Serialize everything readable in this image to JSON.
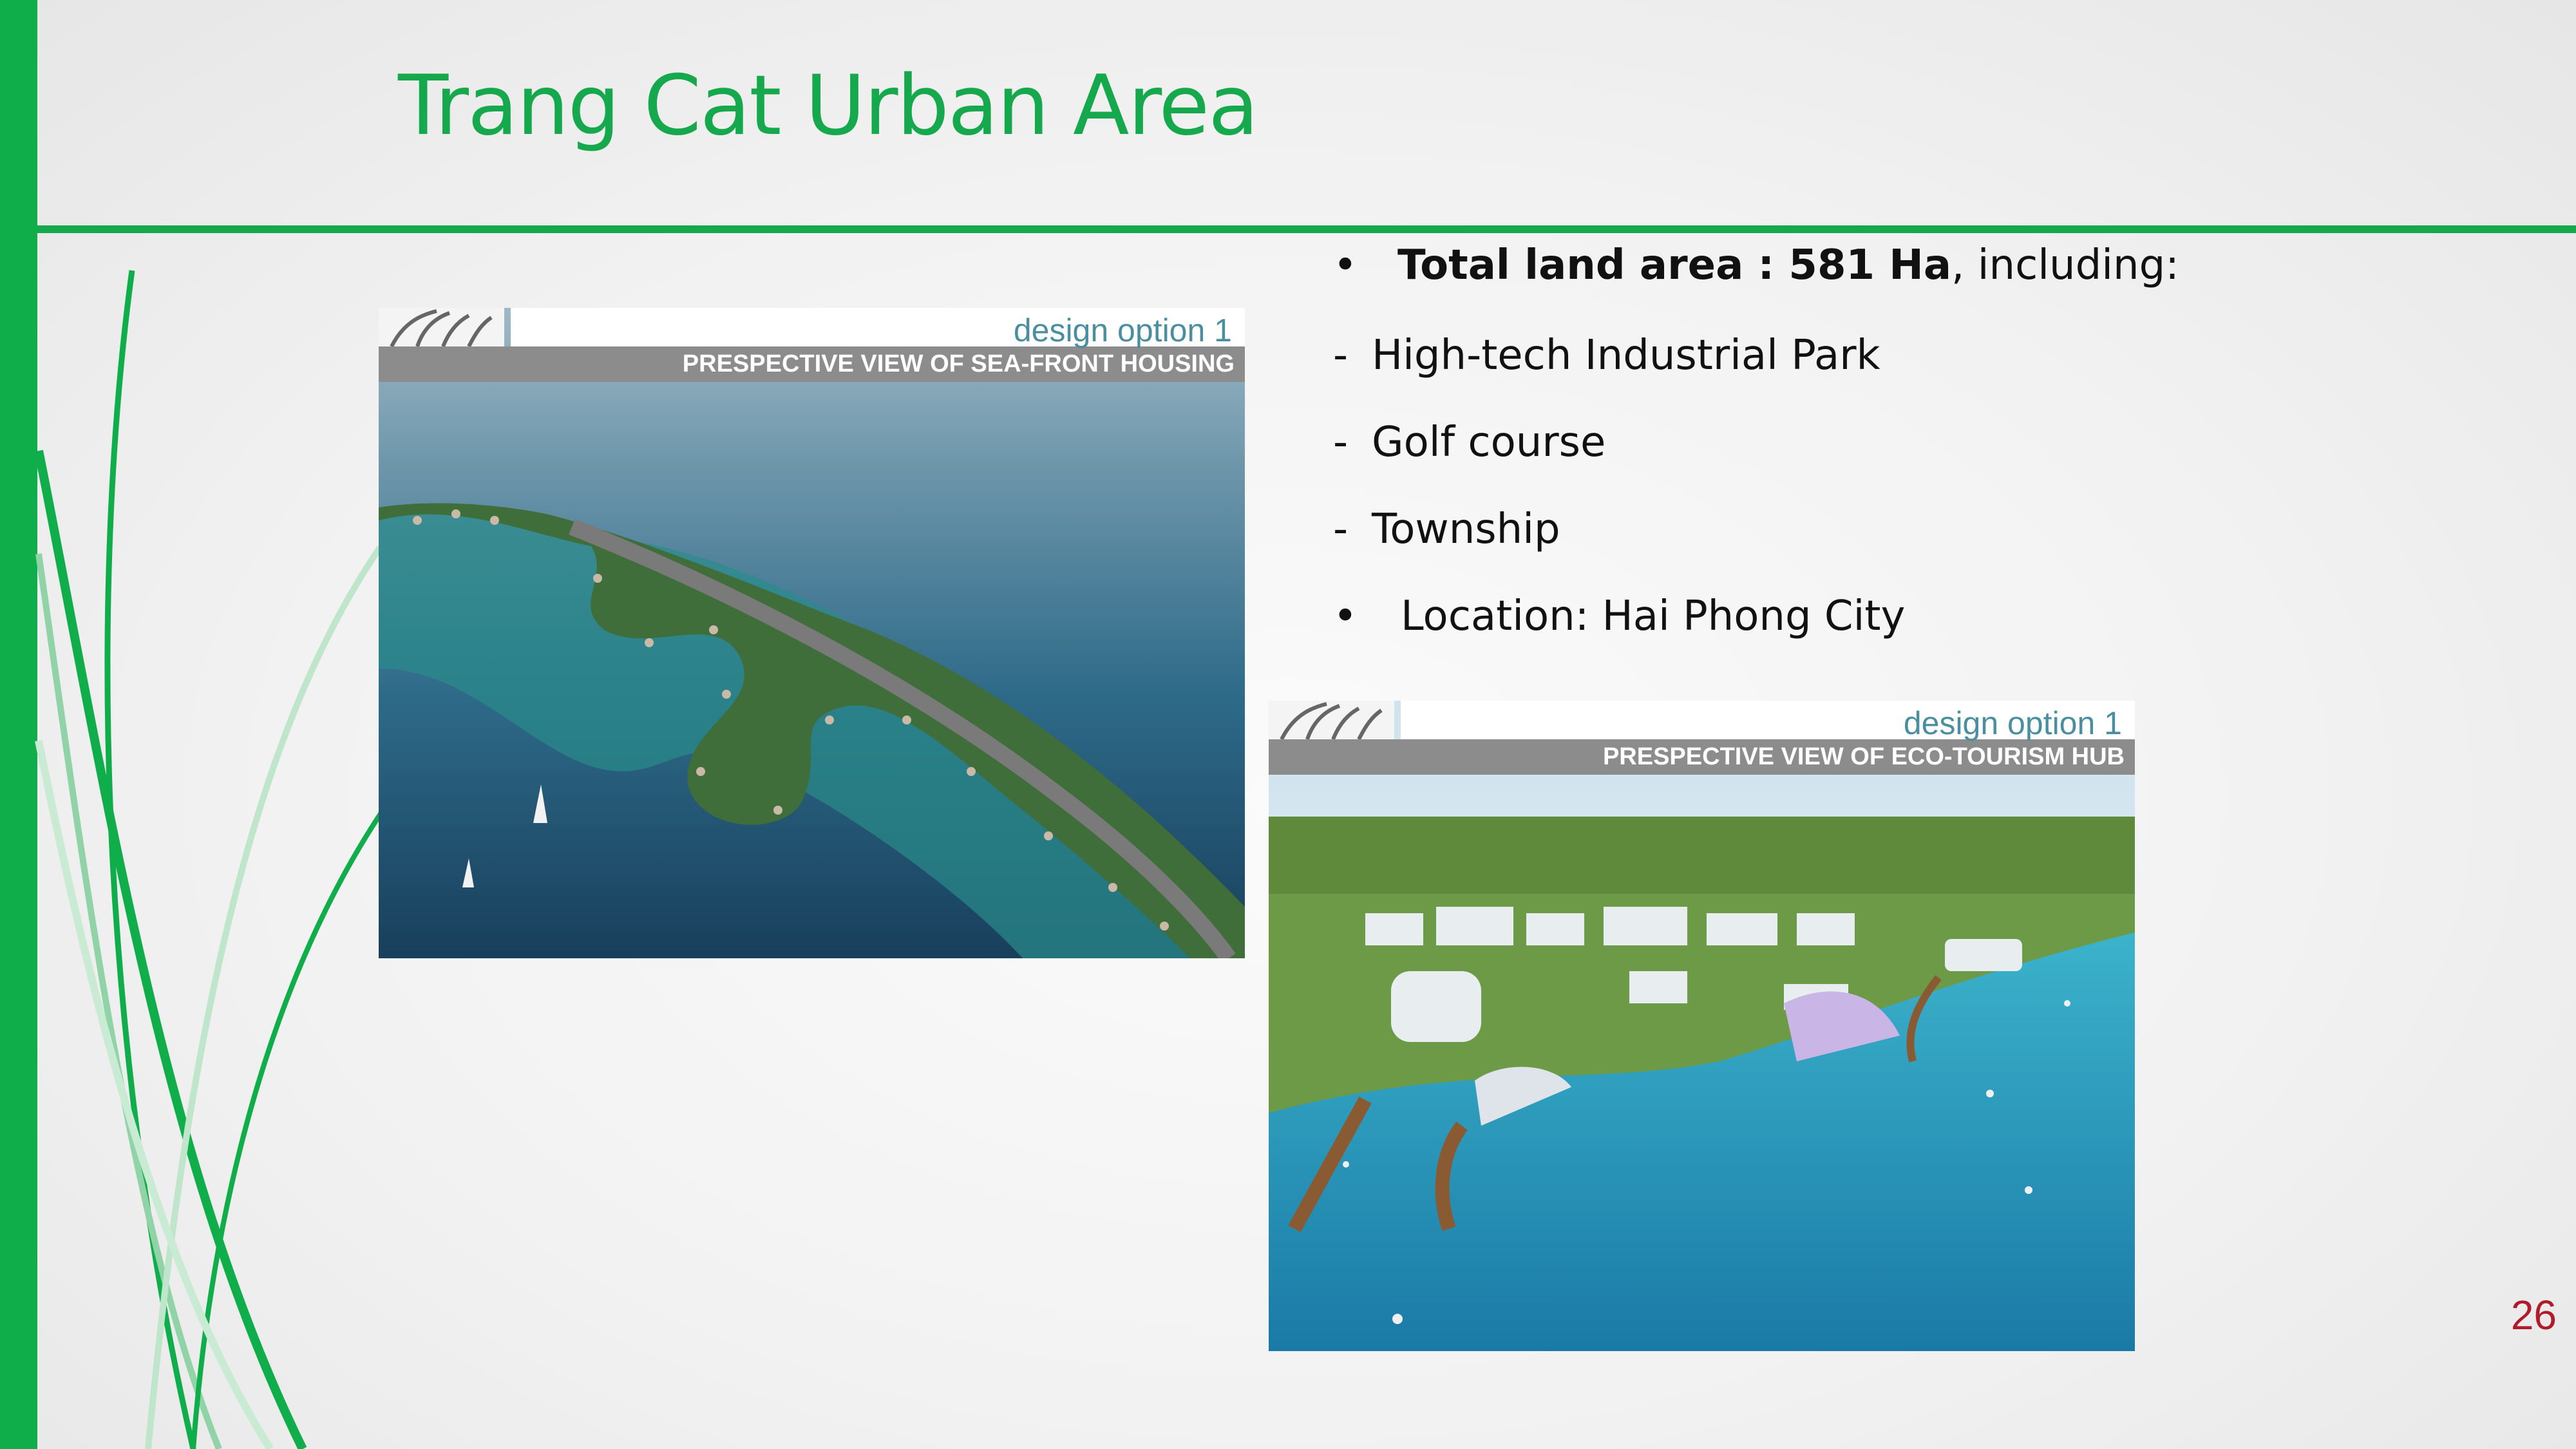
{
  "slide": {
    "title": "Trang Cat Urban Area",
    "page_number": "26",
    "accent_color": "#16a84c"
  },
  "bullets": {
    "total_marker": "•",
    "total_label": "Total land area",
    "total_sep": " : ",
    "total_value": "581 Ha",
    "total_suffix": ", including:",
    "item1_marker": "-",
    "item1": "High-tech Industrial Park",
    "item2_marker": "-",
    "item2": "Golf course",
    "item3_marker": "-",
    "item3": "Township",
    "location_marker": "•",
    "location": "Location: Hai Phong City"
  },
  "photo1": {
    "option": "design option 1",
    "view": "PRESPECTIVE VIEW OF SEA-FRONT HOUSING"
  },
  "photo2": {
    "option": "design option 1",
    "view": "PRESPECTIVE VIEW OF ECO-TOURISM HUB"
  }
}
